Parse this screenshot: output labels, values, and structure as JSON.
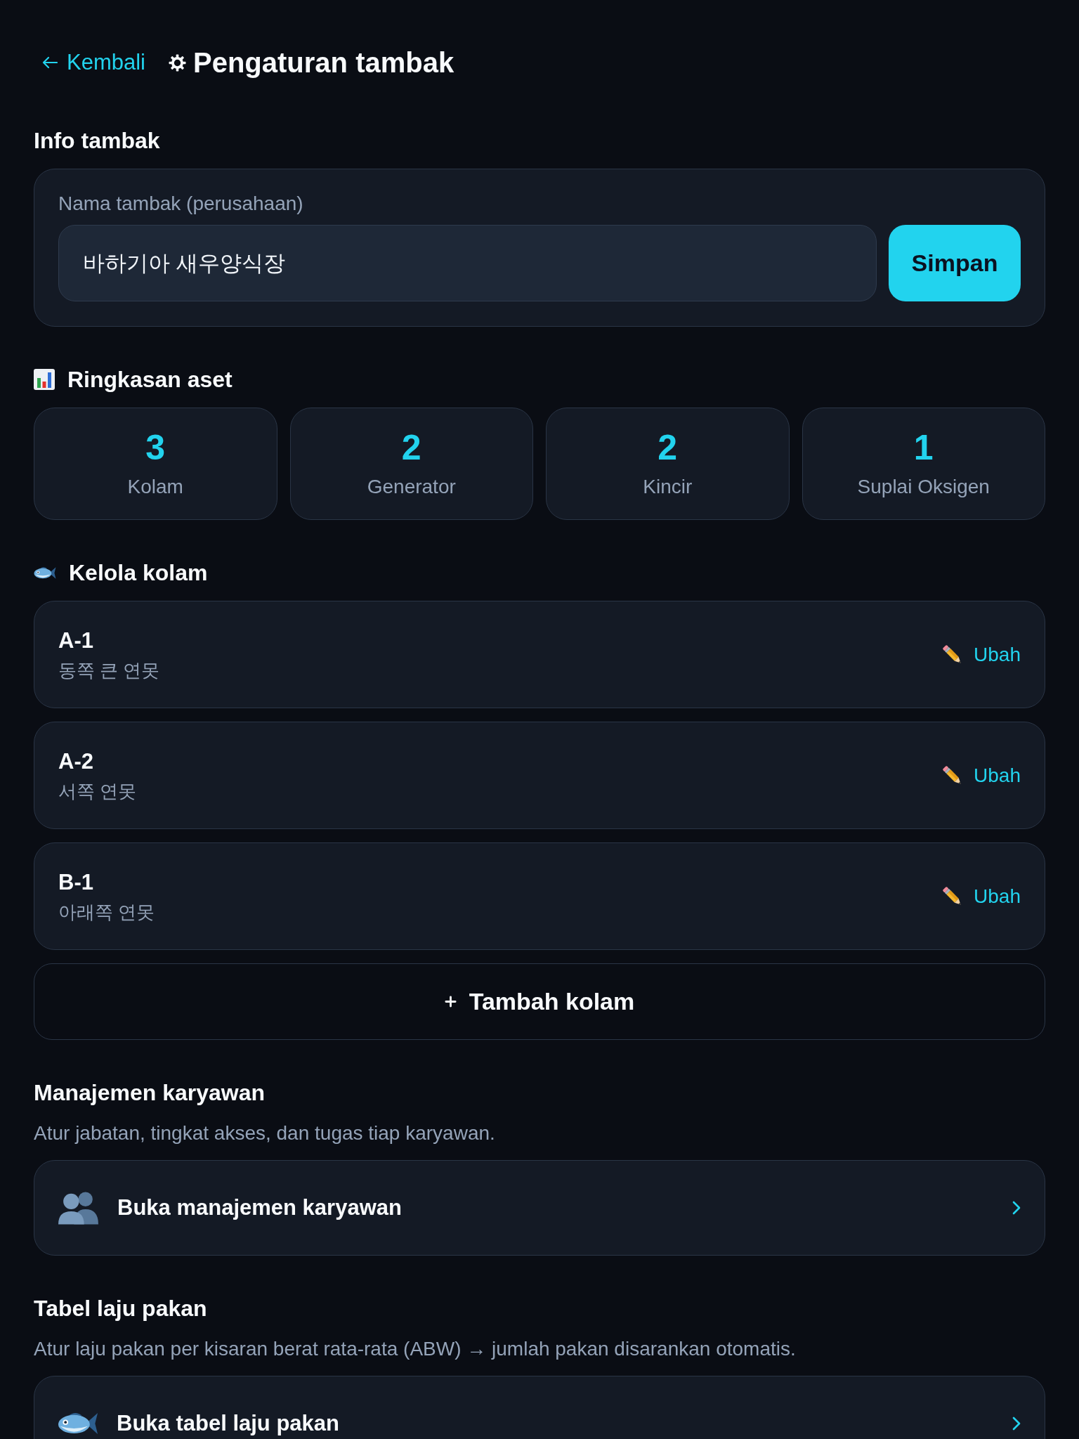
{
  "header": {
    "back_link": "Kembali",
    "title": "Pengaturan tambak"
  },
  "farm_info": {
    "heading": "Info tambak",
    "field": {
      "label": "Nama tambak (perusahaan)",
      "value": "바하기아 새우양식장"
    },
    "save_button": "Simpan"
  },
  "asset_summary": {
    "heading": "Ringkasan aset",
    "stats": [
      {
        "value": "3",
        "label": "Kolam"
      },
      {
        "value": "2",
        "label": "Generator"
      },
      {
        "value": "2",
        "label": "Kincir"
      },
      {
        "value": "1",
        "label": "Suplai Oksigen"
      }
    ]
  },
  "ponds": {
    "heading": "Kelola kolam",
    "items": [
      {
        "name": "A-1",
        "description": "동쪽 큰 연못",
        "action": "Ubah"
      },
      {
        "name": "A-2",
        "description": "서쪽 연못",
        "action": "Ubah"
      },
      {
        "name": "B-1",
        "description": "아래쪽 연못",
        "action": "Ubah"
      }
    ],
    "add_button": "Tambah kolam"
  },
  "links": [
    {
      "kind": "employees",
      "heading": "Manajemen karyawan",
      "description": "Atur jabatan, tingkat akses, dan tugas tiap karyawan.",
      "button": "Buka manajemen karyawan"
    },
    {
      "kind": "feed",
      "heading": "Tabel laju pakan",
      "description": "Atur laju pakan per kisaran berat rata-rata (ABW) → jumlah pakan disarankan otomatis.",
      "button": "Buka tabel laju pakan"
    }
  ]
}
